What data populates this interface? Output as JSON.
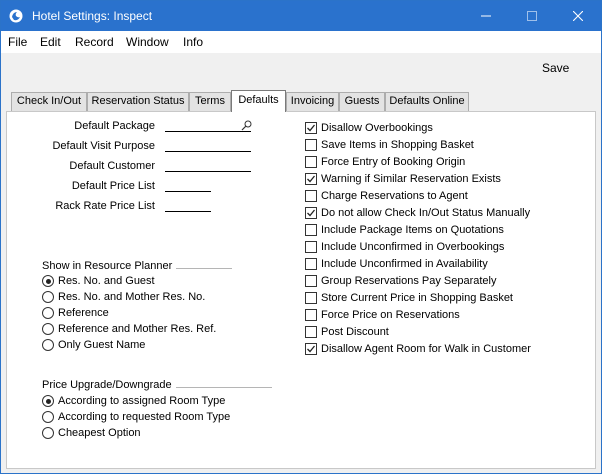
{
  "window": {
    "title": "Hotel Settings: Inspect"
  },
  "menu": [
    "File",
    "Edit",
    "Record",
    "Window",
    "Info"
  ],
  "toolbar": {
    "save_label": "Save"
  },
  "tabs": [
    "Check In/Out",
    "Reservation Status",
    "Terms",
    "Defaults",
    "Invoicing",
    "Guests",
    "Defaults Online"
  ],
  "active_tab": "Defaults",
  "fields": [
    {
      "label": "Default Package",
      "value": ""
    },
    {
      "label": "Default Visit Purpose",
      "value": ""
    },
    {
      "label": "Default Customer",
      "value": ""
    },
    {
      "label": "Default Price List",
      "value": ""
    },
    {
      "label": "Rack Rate Price List",
      "value": ""
    }
  ],
  "planner": {
    "title": "Show in Resource Planner",
    "options": [
      "Res. No. and Guest",
      "Res. No. and Mother Res. No.",
      "Reference",
      "Reference and Mother Res. Ref.",
      "Only Guest Name"
    ],
    "selected": 0
  },
  "upgrade": {
    "title": "Price Upgrade/Downgrade",
    "options": [
      "According to assigned Room Type",
      "According to requested Room Type",
      "Cheapest Option"
    ],
    "selected": 0
  },
  "checkboxes": [
    {
      "label": "Disallow Overbookings",
      "checked": true
    },
    {
      "label": "Save Items in Shopping Basket",
      "checked": false
    },
    {
      "label": "Force Entry of Booking Origin",
      "checked": false
    },
    {
      "label": "Warning if Similar Reservation Exists",
      "checked": true
    },
    {
      "label": "Charge Reservations to Agent",
      "checked": false
    },
    {
      "label": "Do not allow Check In/Out Status Manually",
      "checked": true
    },
    {
      "label": "Include Package Items on Quotations",
      "checked": false
    },
    {
      "label": "Include Unconfirmed in Overbookings",
      "checked": false
    },
    {
      "label": "Include Unconfirmed in Availability",
      "checked": false
    },
    {
      "label": "Group Reservations Pay Separately",
      "checked": false
    },
    {
      "label": "Store Current Price in Shopping Basket",
      "checked": false
    },
    {
      "label": "Force Price on Reservations",
      "checked": false
    },
    {
      "label": "Post Discount",
      "checked": false
    },
    {
      "label": "Disallow Agent Room for Walk in Customer",
      "checked": true
    }
  ]
}
